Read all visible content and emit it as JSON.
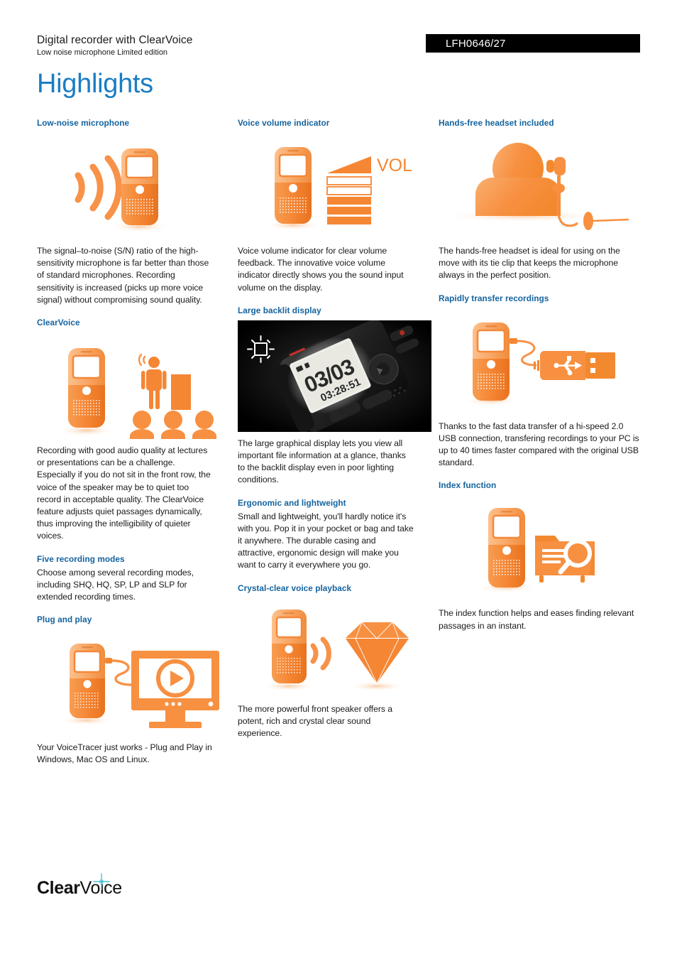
{
  "header": {
    "title": "Digital recorder with ClearVoice",
    "subtitle": "Low noise microphone Limited edition",
    "product_code": "LFH0646/27",
    "page_title": "Highlights"
  },
  "colors": {
    "heading_blue": "#14639e",
    "title_blue": "#1a7dc4",
    "orange": "#f58634",
    "orange_light": "#fbb57a",
    "code_bg": "#000000",
    "sparkle_cyan": "#45c3d8"
  },
  "columns": [
    {
      "sections": [
        {
          "title": "Low-noise microphone",
          "art": "recorder-with-soundwaves",
          "body": "The signal–to-noise (S/N) ratio of the high-sensitivity microphone is far better than those of standard microphones. Recording sensitivity is increased (picks up more voice signal) without compromising sound quality."
        },
        {
          "title": "ClearVoice",
          "art": "recorder-with-audience",
          "body": "Recording with good audio quality at lectures or presentations can be a challenge. Especially if you do not sit in the front row, the voice of the speaker may be to quiet too record in acceptable quality. The ClearVoice feature adjusts quiet passages dynamically, thus improving the intelligibility of quieter voices."
        },
        {
          "title": "Five recording modes",
          "art": null,
          "body": "Choose among several recording modes, including SHQ, HQ, SP, LP and SLP for extended recording times."
        },
        {
          "title": "Plug and play",
          "art": "recorder-with-monitor",
          "body": "Your VoiceTracer just works - Plug and Play in Windows, Mac OS and Linux."
        }
      ]
    },
    {
      "sections": [
        {
          "title": "Voice volume indicator",
          "art": "recorder-with-vol-meter",
          "art_label": "VOL",
          "body": "Voice volume indicator for clear volume feedback. The innovative voice volume indicator directly shows you the sound input volume on the display."
        },
        {
          "title": "Large backlit display",
          "art": "backlit-display-photo",
          "lcd_file": "03/03",
          "lcd_time": "03:28:51",
          "body": "The large graphical display lets you view all important file information at a glance, thanks to the backlit display even in poor lighting conditions."
        },
        {
          "title": "Ergonomic and lightweight",
          "art": null,
          "body": "Small and lightweight, you'll hardly notice it's with you. Pop it in your pocket or bag and take it anywhere. The durable casing and attractive, ergonomic design will make you want to carry it everywhere you go."
        },
        {
          "title": "Crystal-clear voice playback",
          "art": "recorder-with-diamond",
          "body": "The more powerful front speaker offers a potent, rich and crystal clear sound experience."
        }
      ]
    },
    {
      "sections": [
        {
          "title": "Hands-free headset included",
          "art": "person-with-headset",
          "body": "The hands-free headset is ideal for using on the move with its tie clip that keeps the microphone always in the perfect position."
        },
        {
          "title": "Rapidly transfer recordings",
          "art": "recorder-with-usb",
          "body": "Thanks to the fast data transfer of a hi-speed 2.0 USB connection, transfering recordings to your PC is up to 40 times faster compared with the original USB standard."
        },
        {
          "title": "Index function",
          "art": "recorder-with-folder-search",
          "body": "The index function helps and eases finding relevant passages in an instant."
        }
      ]
    }
  ],
  "footer": {
    "logo_bold": "Clear",
    "logo_normal": "Voice"
  }
}
